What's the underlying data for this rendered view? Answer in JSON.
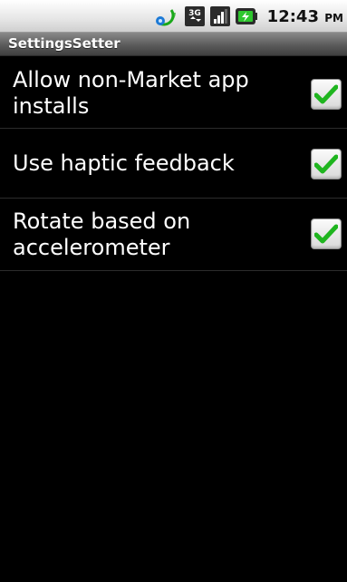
{
  "status_bar": {
    "time": "12:43",
    "ampm": "PM",
    "network_type": "3G",
    "icons": [
      "sync-icon",
      "network-3g-icon",
      "signal-icon",
      "battery-charging-icon"
    ]
  },
  "app_title": "SettingsSetter",
  "settings": [
    {
      "label": "Allow non-Market app installs",
      "checked": true
    },
    {
      "label": "Use haptic feedback",
      "checked": true
    },
    {
      "label": "Rotate based on accelerometer",
      "checked": true
    }
  ],
  "colors": {
    "background": "#000000",
    "text": "#ffffff",
    "check_green": "#1fb51f"
  }
}
